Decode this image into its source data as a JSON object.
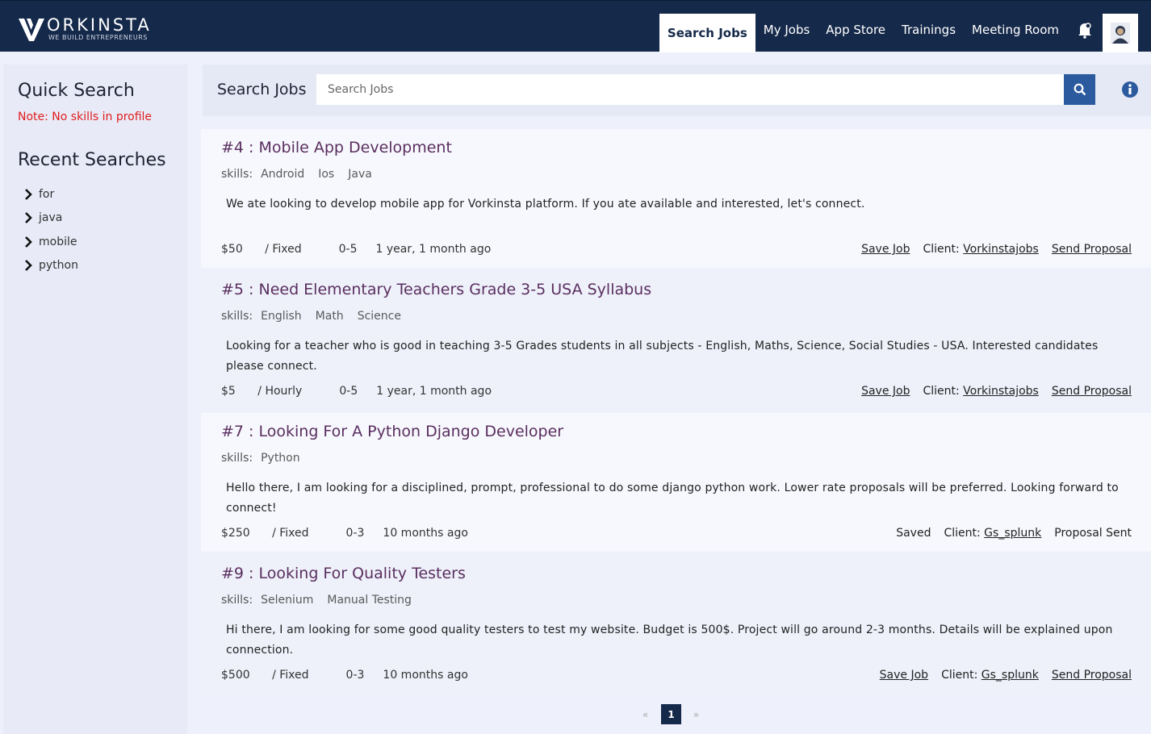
{
  "brand": {
    "name": "ORKINSTA",
    "tagline": "WE BUILD ENTREPRENEURS"
  },
  "nav": {
    "items": [
      {
        "label": "Search Jobs",
        "active": true
      },
      {
        "label": "My Jobs"
      },
      {
        "label": "App Store"
      },
      {
        "label": "Trainings"
      },
      {
        "label": "Meeting Room"
      }
    ],
    "icons": [
      "notification-icon",
      "avatar"
    ]
  },
  "sidebar": {
    "quick_search": "Quick Search",
    "note": "Note: No skills in profile",
    "recent_title": "Recent Searches",
    "recent": [
      "for",
      "java",
      "mobile",
      "python"
    ]
  },
  "search": {
    "label": "Search Jobs",
    "placeholder": "Search Jobs",
    "value": ""
  },
  "jobs": [
    {
      "title": "#4 : Mobile App Development",
      "skills_label": "skills:",
      "skills": [
        "Android",
        "Ios",
        "Java"
      ],
      "description": "We ate looking to develop mobile app for Vorkinsta platform. If you ate available and interested, let's connect.",
      "price": "$50",
      "price_type": "/ Fixed",
      "experience": "0-5",
      "posted": "1 year, 1 month ago",
      "save": "Save Job",
      "client_label": "Client:",
      "client": "Vorkinstajobs",
      "proposal": "Send Proposal"
    },
    {
      "title": "#5 : Need Elementary Teachers Grade 3-5 USA Syllabus",
      "skills_label": "skills:",
      "skills": [
        "English",
        "Math",
        "Science"
      ],
      "description": "Looking for a teacher who is good in teaching 3-5 Grades students in all subjects - English, Maths, Science, Social Studies - USA. Interested candidates please connect.",
      "price": "$5",
      "price_type": "/ Hourly",
      "experience": "0-5",
      "posted": "1 year, 1 month ago",
      "save": "Save Job",
      "client_label": "Client:",
      "client": "Vorkinstajobs",
      "proposal": "Send Proposal"
    },
    {
      "title": "#7 : Looking For A Python Django Developer",
      "skills_label": "skills:",
      "skills": [
        "Python"
      ],
      "description": "Hello there, I am looking for a disciplined, prompt, professional to do some django python work. Lower rate proposals will be preferred. Looking forward to connect!",
      "price": "$250",
      "price_type": "/ Fixed",
      "experience": "0-3",
      "posted": "10 months ago",
      "save": "Saved",
      "client_label": "Client:",
      "client": "Gs_splunk",
      "proposal": "Proposal Sent"
    },
    {
      "title": "#9 : Looking For Quality Testers",
      "skills_label": "skills:",
      "skills": [
        "Selenium",
        "Manual Testing"
      ],
      "description": "Hi there, I am looking for some good quality testers to test my website. Budget is 500$. Project will go around 2-3 months. Details will be explained upon connection.",
      "price": "$500",
      "price_type": "/ Fixed",
      "experience": "0-3",
      "posted": "10 months ago",
      "save": "Save Job",
      "client_label": "Client:",
      "client": "Gs_splunk",
      "proposal": "Send Proposal"
    }
  ],
  "pagination": {
    "prev": "«",
    "current": "1",
    "next": "»"
  },
  "colors": {
    "navbar": "#15294a",
    "accent": "#2b5a9e",
    "title": "#5a2e5f",
    "note": "#e01c1c"
  }
}
